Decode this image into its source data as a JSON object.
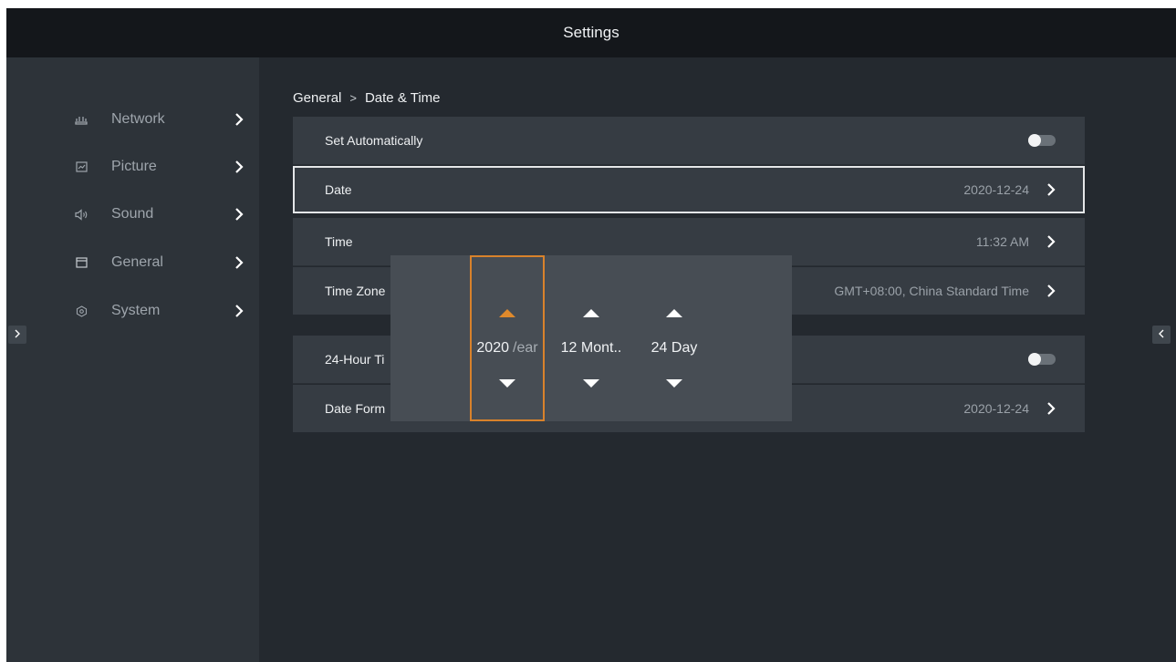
{
  "title": "Settings",
  "sidebar": {
    "items": [
      {
        "label": "Network",
        "icon": "network-icon"
      },
      {
        "label": "Picture",
        "icon": "picture-icon"
      },
      {
        "label": "Sound",
        "icon": "sound-icon"
      },
      {
        "label": "General",
        "icon": "general-icon"
      },
      {
        "label": "System",
        "icon": "system-icon"
      }
    ]
  },
  "breadcrumb": {
    "parent": "General",
    "separator": ">",
    "current": "Date & Time"
  },
  "rows": {
    "set_auto": {
      "label": "Set Automatically",
      "toggle": "off"
    },
    "date": {
      "label": "Date",
      "value": "2020-12-24"
    },
    "time": {
      "label": "Time",
      "value": "11:32 AM"
    },
    "timezone": {
      "label": "Time Zone",
      "value": "GMT+08:00, China Standard Time"
    },
    "hour24": {
      "label": "24-Hour Ti",
      "toggle": "off"
    },
    "date_format": {
      "label": "Date Form",
      "value": "2020-12-24"
    }
  },
  "picker": {
    "year": {
      "number": "2020",
      "unit": "/ear"
    },
    "month": {
      "text": "12 Mont.."
    },
    "day": {
      "text": "24 Day"
    }
  },
  "colors": {
    "accent": "#d9822b",
    "background": "#24292f",
    "sidebar": "#2d3339"
  }
}
